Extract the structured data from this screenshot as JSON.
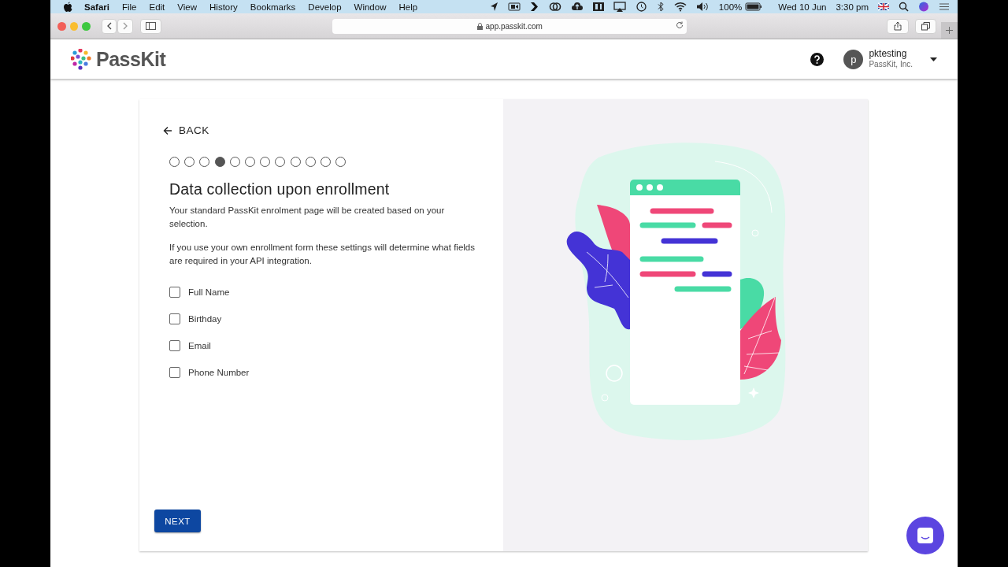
{
  "menu_bar": {
    "app_name": "Safari",
    "menus": [
      "File",
      "Edit",
      "View",
      "History",
      "Bookmarks",
      "Develop",
      "Window",
      "Help"
    ],
    "battery": "100%",
    "date": "Wed 10 Jun",
    "time": "3:30 pm"
  },
  "browser": {
    "url": "app.passkit.com"
  },
  "header": {
    "logo": "PassKit",
    "user": {
      "initial": "p",
      "name": "pktesting",
      "organization": "PassKit, Inc."
    }
  },
  "wizard": {
    "back": "BACK",
    "steps": [
      {
        "selected": false
      },
      {
        "selected": false
      },
      {
        "selected": false
      },
      {
        "selected": true
      },
      {
        "selected": false
      },
      {
        "selected": false
      },
      {
        "selected": false
      },
      {
        "selected": false
      },
      {
        "selected": false
      },
      {
        "selected": false
      },
      {
        "selected": false
      },
      {
        "selected": false
      }
    ],
    "title": "Data collection upon enrollment",
    "paragraphs": [
      "Your standard PassKit enrolment page will be created based on your selection.",
      "If you use your own enrollment form these settings will determine what fields are required in your API integration."
    ],
    "fields": [
      {
        "label": "Full Name",
        "checked": false
      },
      {
        "label": "Birthday",
        "checked": false
      },
      {
        "label": "Email",
        "checked": false
      },
      {
        "label": "Phone Number",
        "checked": false
      }
    ],
    "next": "NEXT"
  }
}
